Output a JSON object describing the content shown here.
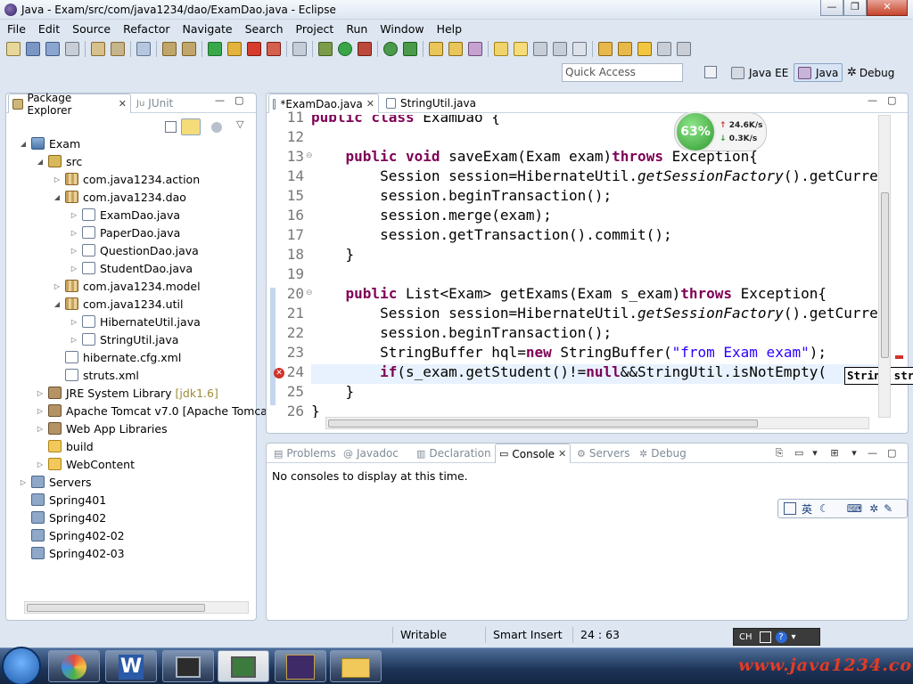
{
  "window": {
    "title": "Java - Exam/src/com/java1234/dao/ExamDao.java - Eclipse"
  },
  "menu": [
    "File",
    "Edit",
    "Source",
    "Refactor",
    "Navigate",
    "Search",
    "Project",
    "Run",
    "Window",
    "Help"
  ],
  "quick_access": {
    "placeholder": "Quick Access"
  },
  "perspectives": {
    "java_ee": "Java EE",
    "java": "Java",
    "debug": "Debug"
  },
  "left_panel": {
    "tabs": [
      "Package Explorer",
      "JUnit"
    ],
    "tree": [
      {
        "label": "Exam",
        "depth": 0,
        "icon": "project-icon",
        "expanded": true
      },
      {
        "label": "src",
        "depth": 1,
        "icon": "source-folder-icon",
        "expanded": true
      },
      {
        "label": "com.java1234.action",
        "depth": 2,
        "icon": "package-icon",
        "expanded": false
      },
      {
        "label": "com.java1234.dao",
        "depth": 2,
        "icon": "package-icon",
        "expanded": true
      },
      {
        "label": "ExamDao.java",
        "depth": 3,
        "icon": "java-file-icon",
        "expanded": false
      },
      {
        "label": "PaperDao.java",
        "depth": 3,
        "icon": "java-file-icon",
        "expanded": false
      },
      {
        "label": "QuestionDao.java",
        "depth": 3,
        "icon": "java-file-icon",
        "expanded": false
      },
      {
        "label": "StudentDao.java",
        "depth": 3,
        "icon": "java-file-icon",
        "expanded": false
      },
      {
        "label": "com.java1234.model",
        "depth": 2,
        "icon": "package-icon",
        "expanded": false
      },
      {
        "label": "com.java1234.util",
        "depth": 2,
        "icon": "package-icon",
        "expanded": true
      },
      {
        "label": "HibernateUtil.java",
        "depth": 3,
        "icon": "java-file-icon",
        "expanded": false
      },
      {
        "label": "StringUtil.java",
        "depth": 3,
        "icon": "java-file-icon",
        "expanded": false
      },
      {
        "label": "hibernate.cfg.xml",
        "depth": 2,
        "icon": "xml-file-icon",
        "expanded": null
      },
      {
        "label": "struts.xml",
        "depth": 2,
        "icon": "xml-file-icon",
        "expanded": null
      },
      {
        "label": "JRE System Library",
        "suffix": "[jdk1.6]",
        "depth": 1,
        "icon": "library-icon",
        "expanded": false
      },
      {
        "label": "Apache Tomcat v7.0 [Apache Tomca",
        "depth": 1,
        "icon": "library-icon",
        "expanded": false
      },
      {
        "label": "Web App Libraries",
        "depth": 1,
        "icon": "library-icon",
        "expanded": false
      },
      {
        "label": "build",
        "depth": 1,
        "icon": "folder-icon",
        "expanded": null
      },
      {
        "label": "WebContent",
        "depth": 1,
        "icon": "folder-icon",
        "expanded": false
      },
      {
        "label": "Servers",
        "depth": 0,
        "icon": "server-folder-icon",
        "expanded": false
      },
      {
        "label": "Spring401",
        "depth": 0,
        "icon": "server-folder-icon",
        "expanded": null
      },
      {
        "label": "Spring402",
        "depth": 0,
        "icon": "server-folder-icon",
        "expanded": null
      },
      {
        "label": "Spring402-02",
        "depth": 0,
        "icon": "server-folder-icon",
        "expanded": null
      },
      {
        "label": "Spring402-03",
        "depth": 0,
        "icon": "server-folder-icon",
        "expanded": null
      }
    ]
  },
  "editor": {
    "tabs": [
      {
        "label": "*ExamDao.java",
        "active": true
      },
      {
        "label": "StringUtil.java",
        "active": false
      }
    ],
    "lines": [
      {
        "n": "11",
        "fold": "",
        "code": [
          {
            "t": "public class ",
            "c": "kw"
          },
          {
            "t": "ExamDao {",
            "c": ""
          }
        ]
      },
      {
        "n": "12",
        "fold": "",
        "code": []
      },
      {
        "n": "13",
        "fold": "⊖",
        "code": [
          {
            "t": "    ",
            "c": ""
          },
          {
            "t": "public void ",
            "c": "kw"
          },
          {
            "t": "saveExam(Exam exam)",
            "c": ""
          },
          {
            "t": "throws ",
            "c": "kw"
          },
          {
            "t": "Exception{",
            "c": ""
          }
        ]
      },
      {
        "n": "14",
        "fold": "",
        "code": [
          {
            "t": "        Session session=HibernateUtil.",
            "c": ""
          },
          {
            "t": "getSessionFactory",
            "c": "it"
          },
          {
            "t": "().getCurrentSession();",
            "c": ""
          }
        ]
      },
      {
        "n": "15",
        "fold": "",
        "code": [
          {
            "t": "        session.beginTransaction();",
            "c": ""
          }
        ]
      },
      {
        "n": "16",
        "fold": "",
        "code": [
          {
            "t": "        session.merge(exam);",
            "c": ""
          }
        ]
      },
      {
        "n": "17",
        "fold": "",
        "code": [
          {
            "t": "        session.getTransaction().commit();",
            "c": ""
          }
        ]
      },
      {
        "n": "18",
        "fold": "",
        "code": [
          {
            "t": "    }",
            "c": ""
          }
        ]
      },
      {
        "n": "19",
        "fold": "",
        "code": []
      },
      {
        "n": "20",
        "fold": "⊖",
        "code": [
          {
            "t": "    ",
            "c": ""
          },
          {
            "t": "public ",
            "c": "kw"
          },
          {
            "t": "List<Exam> getExams(Exam s_exam)",
            "c": ""
          },
          {
            "t": "throws ",
            "c": "kw"
          },
          {
            "t": "Exception{",
            "c": ""
          }
        ]
      },
      {
        "n": "21",
        "fold": "",
        "code": [
          {
            "t": "        Session session=HibernateUtil.",
            "c": ""
          },
          {
            "t": "getSessionFactory",
            "c": "it"
          },
          {
            "t": "().getCurrentSession();",
            "c": ""
          }
        ]
      },
      {
        "n": "22",
        "fold": "",
        "code": [
          {
            "t": "        session.beginTransaction();",
            "c": ""
          }
        ]
      },
      {
        "n": "23",
        "fold": "",
        "code": [
          {
            "t": "        StringBuffer hql=",
            "c": ""
          },
          {
            "t": "new ",
            "c": "kw"
          },
          {
            "t": "StringBuffer(",
            "c": ""
          },
          {
            "t": "\"from Exam exam\"",
            "c": "st"
          },
          {
            "t": ");",
            "c": ""
          }
        ]
      },
      {
        "n": "24",
        "fold": "",
        "code": [
          {
            "t": "        ",
            "c": ""
          },
          {
            "t": "if",
            "c": "kw"
          },
          {
            "t": "(s_exam.getStudent()!=",
            "c": ""
          },
          {
            "t": "null",
            "c": "kw"
          },
          {
            "t": "&&StringUtil.isNotEmpty(",
            "c": ""
          }
        ]
      },
      {
        "n": "25",
        "fold": "",
        "code": [
          {
            "t": "    }",
            "c": ""
          }
        ]
      },
      {
        "n": "26",
        "fold": "",
        "code": [
          {
            "t": "}",
            "c": ""
          }
        ]
      }
    ],
    "tooltip": "String str"
  },
  "net_speed": {
    "percent": "63%",
    "up": "24.6K/s",
    "down": "0.3K/s"
  },
  "bottom_panel": {
    "tabs": [
      {
        "label": "Problems",
        "active": false
      },
      {
        "label": "Javadoc",
        "active": false
      },
      {
        "label": "Declaration",
        "active": false
      },
      {
        "label": "Console",
        "active": true
      },
      {
        "label": "Servers",
        "active": false
      },
      {
        "label": "Debug",
        "active": false
      }
    ],
    "message": "No consoles to display at this time."
  },
  "status": {
    "writable": "Writable",
    "insert_mode": "Smart Insert",
    "position": "24 : 63"
  },
  "ime": {
    "lang": "英",
    "tray_lang": "CH"
  },
  "watermark": "www.java1234.com"
}
